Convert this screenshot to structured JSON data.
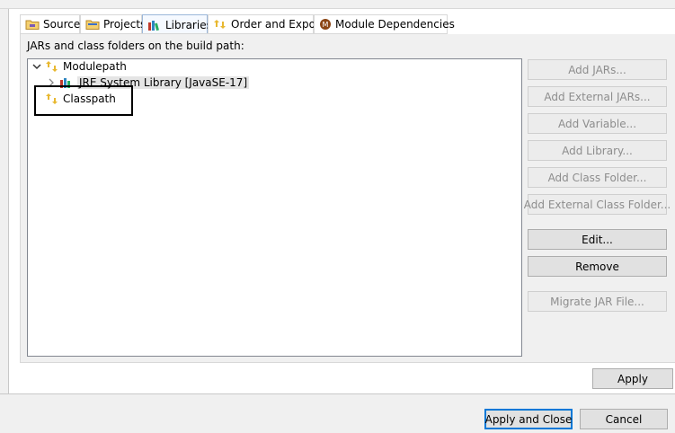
{
  "tabs": [
    {
      "label": "Source",
      "icon": "source-folder-icon",
      "selected": false
    },
    {
      "label": "Projects",
      "icon": "projects-folder-icon",
      "selected": false
    },
    {
      "label": "Libraries",
      "icon": "libraries-icon",
      "selected": true
    },
    {
      "label": "Order and Export",
      "icon": "order-export-icon",
      "selected": false
    },
    {
      "label": "Module Dependencies",
      "icon": "module-dependencies-icon",
      "selected": false
    }
  ],
  "caption": "JARs and class folders on the build path:",
  "tree": {
    "modulepath": {
      "label": "Modulepath",
      "expanded": true
    },
    "jre": {
      "label": "JRE System Library [JavaSE-17]"
    },
    "classpath": {
      "label": "Classpath"
    }
  },
  "buttons": {
    "add_jars": "Add JARs...",
    "add_external_jars": "Add External JARs...",
    "add_variable": "Add Variable...",
    "add_library": "Add Library...",
    "add_class_folder": "Add Class Folder...",
    "add_external_class_folder": "Add External Class Folder...",
    "edit": "Edit...",
    "remove": "Remove",
    "migrate_jar": "Migrate JAR File..."
  },
  "footer": {
    "apply": "Apply",
    "apply_and_close": "Apply and Close",
    "cancel": "Cancel"
  },
  "colors": {
    "focus_border": "#0078d7",
    "selection": "#e5e5e5",
    "disabled_text": "#8d8d8d"
  }
}
